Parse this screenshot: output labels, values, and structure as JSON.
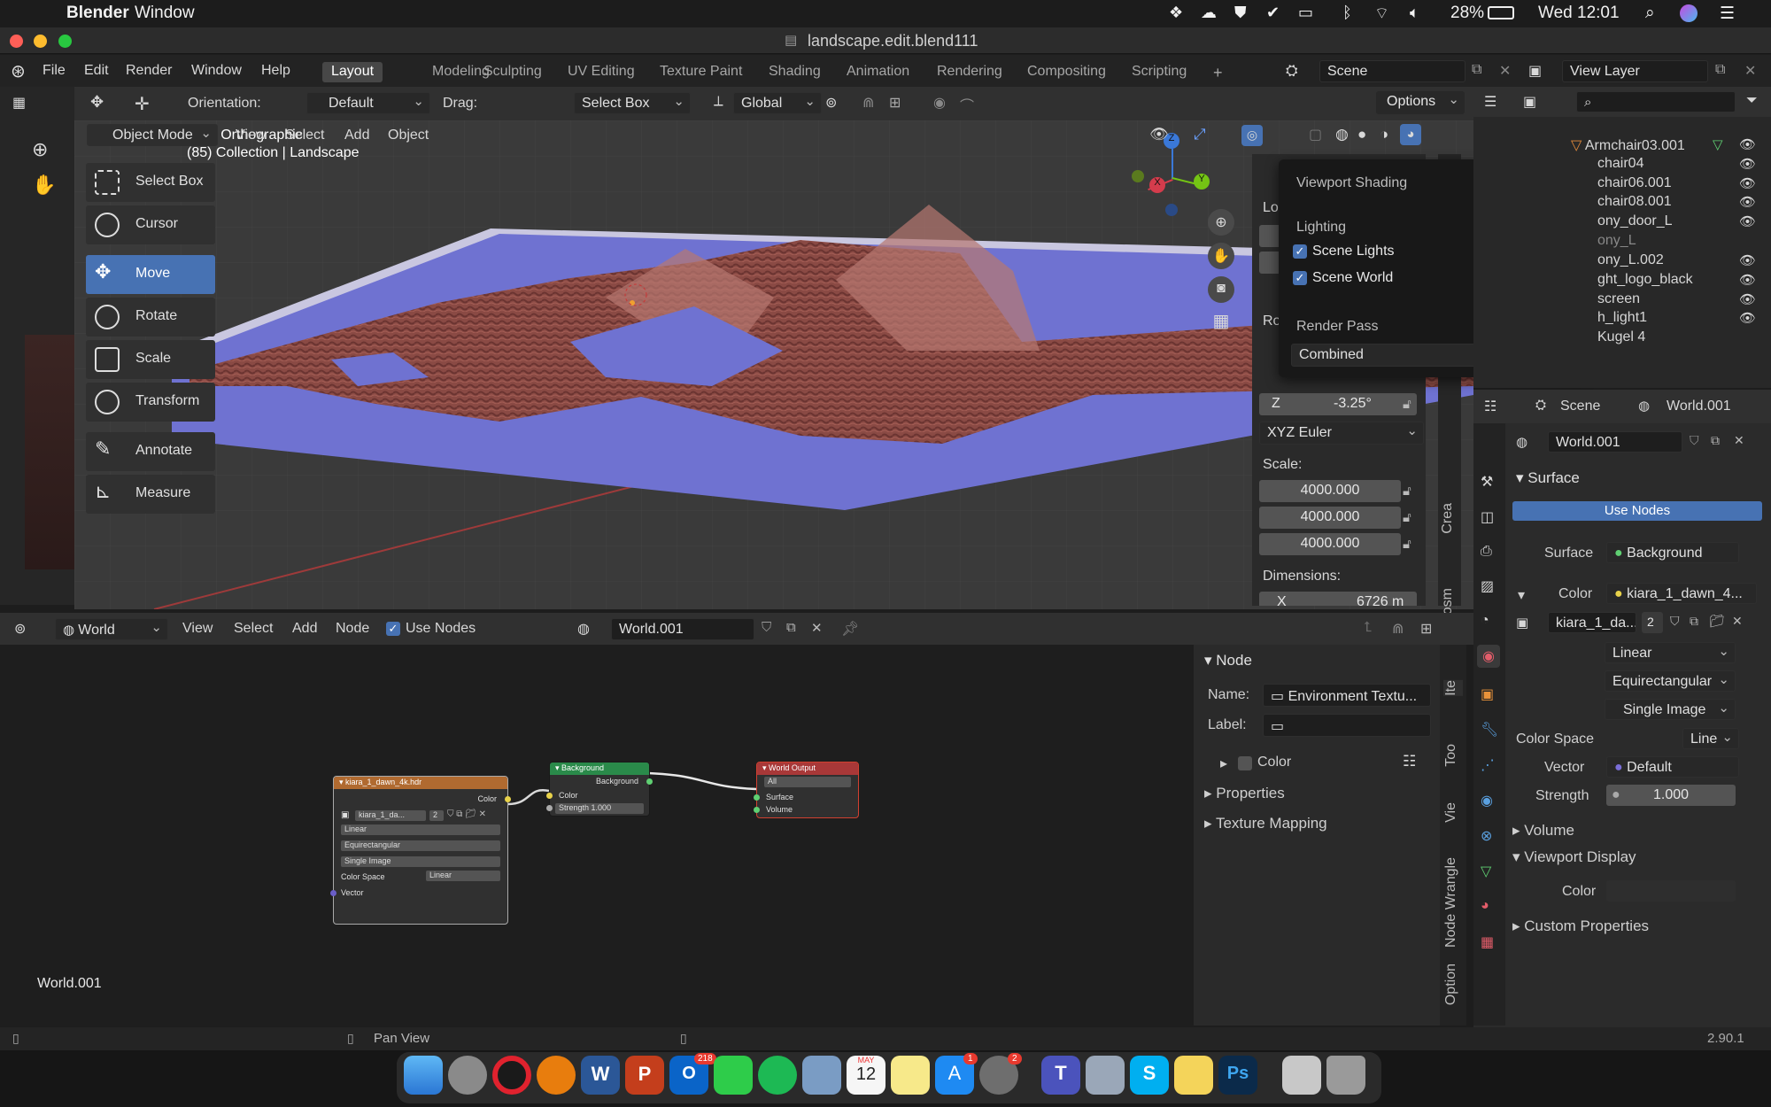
{
  "menubar": {
    "app_name": "Blender",
    "window_menu": "Window",
    "battery": "28%",
    "clock": "Wed 12:01"
  },
  "titlebar": {
    "filename": "landscape.edit.blend111"
  },
  "topbar": {
    "menus": [
      "File",
      "Edit",
      "Render",
      "Window",
      "Help"
    ],
    "workspaces": [
      "Layout",
      "Modeling",
      "Sculpting",
      "UV Editing",
      "Texture Paint",
      "Shading",
      "Animation",
      "Rendering",
      "Compositing",
      "Scripting"
    ],
    "active_workspace": "Layout",
    "add_workspace": "+",
    "scene": "Scene",
    "view_layer": "View Layer"
  },
  "tool_header": {
    "orientation_label": "Orientation:",
    "orientation_value": "Default",
    "drag_label": "Drag:",
    "drag_value": "Select Box",
    "transform_orientation": "Global",
    "options_label": "Options"
  },
  "viewport_header": {
    "mode": "Object Mode",
    "menus": [
      "View",
      "Select",
      "Add",
      "Object"
    ]
  },
  "viewport": {
    "view_name": "User Orthographic",
    "collection_info": "(85) Collection | Landscape",
    "gizmo_axes": {
      "z": "Z",
      "y": "Y",
      "x": "X"
    }
  },
  "toolbar": {
    "tools": [
      {
        "label": "Select Box",
        "icon": "select-box-icon"
      },
      {
        "label": "Cursor",
        "icon": "cursor-icon"
      },
      {
        "label": "Move",
        "icon": "move-icon",
        "active": true
      },
      {
        "label": "Rotate",
        "icon": "rotate-icon"
      },
      {
        "label": "Scale",
        "icon": "scale-icon"
      },
      {
        "label": "Transform",
        "icon": "transform-icon"
      },
      {
        "label": "Annotate",
        "icon": "annotate-icon"
      },
      {
        "label": "Measure",
        "icon": "measure-icon"
      }
    ]
  },
  "shading_popover": {
    "title": "Viewport Shading",
    "lighting_label": "Lighting",
    "scene_lights": "Scene Lights",
    "scene_world": "Scene World",
    "render_pass_label": "Render Pass",
    "render_pass_value": "Combined"
  },
  "n_panel": {
    "location_label_partial": "Lo",
    "rotation_label_partial": "Ro",
    "rot_z_label": "Z",
    "rot_z_value": "-3.25°",
    "rotation_mode": "XYZ Euler",
    "scale_label": "Scale:",
    "scale_values": [
      "4000.000",
      "4000.000",
      "4000.000"
    ],
    "dimensions_label": "Dimensions:",
    "dim_x_label": "X",
    "dim_x_value": "6726 m",
    "tabs": [
      "Crea",
      "osm"
    ]
  },
  "outliner": {
    "items": [
      {
        "name": "Armchair03.001"
      },
      {
        "name": "chair04"
      },
      {
        "name": "chair06.001"
      },
      {
        "name": "chair08.001"
      },
      {
        "name": "ony_door_L"
      },
      {
        "name": "ony_L"
      },
      {
        "name": "ony_L.002"
      },
      {
        "name": "ght_logo_black"
      },
      {
        "name": "screen"
      },
      {
        "name": "h_light1"
      },
      {
        "name": "Kugel 4"
      }
    ]
  },
  "properties": {
    "scene_crumb": "Scene",
    "world_crumb": "World.001",
    "world_name": "World.001",
    "surface_panel": "Surface",
    "use_nodes": "Use Nodes",
    "surface_label": "Surface",
    "surface_value": "Background",
    "color_label": "Color",
    "color_value": "kiara_1_dawn_4...",
    "image_name": "kiara_1_da...",
    "image_users": "2",
    "interpolation": "Linear",
    "projection": "Equirectangular",
    "source": "Single Image",
    "color_space_label": "Color Space",
    "color_space_value": "Line",
    "vector_label": "Vector",
    "vector_value": "Default",
    "strength_label": "Strength",
    "strength_value": "1.000",
    "volume_panel": "Volume",
    "viewport_display_panel": "Viewport Display",
    "vd_color_label": "Color",
    "custom_props_panel": "Custom Properties"
  },
  "node_editor_header": {
    "editor_type": "World",
    "menus": [
      "View",
      "Select",
      "Add",
      "Node"
    ],
    "use_nodes": "Use Nodes",
    "world_name": "World.001"
  },
  "node_editor": {
    "world_label": "World.001",
    "env_node": {
      "title": "kiara_1_dawn_4k.hdr",
      "output": "Color",
      "image": "kiara_1_da...",
      "users": "2",
      "interpolation": "Linear",
      "projection": "Equirectangular",
      "source": "Single Image",
      "color_space_label": "Color Space",
      "color_space_value": "Linear",
      "vector": "Vector"
    },
    "bg_node": {
      "title": "Background",
      "output": "Background",
      "color": "Color",
      "strength_label": "Strength",
      "strength_value": "1.000"
    },
    "out_node": {
      "title": "World Output",
      "target": "All",
      "surface": "Surface",
      "volume": "Volume"
    }
  },
  "node_sidebar": {
    "node_panel": "Node",
    "name_label": "Name:",
    "name_value": "Environment Textu...",
    "label_label": "Label:",
    "color_label": "Color",
    "properties_panel": "Properties",
    "texture_mapping_panel": "Texture Mapping",
    "tabs": [
      "Ite",
      "Too",
      "Vie",
      "Node Wrangle",
      "Option"
    ]
  },
  "statusbar": {
    "pan_view": "Pan View",
    "version": "2.90.1"
  },
  "dock": {
    "calendar_month": "MAY",
    "calendar_day": "12",
    "outlook_badge": "218",
    "appstore_badge": "1",
    "prefs_badge": "2"
  },
  "colors": {
    "accent_blue": "#4772b3",
    "panel_bg": "#303030",
    "viewport_bg": "#3a3a3a",
    "water": "#6f72d1",
    "terrain": "#8a4a44"
  }
}
